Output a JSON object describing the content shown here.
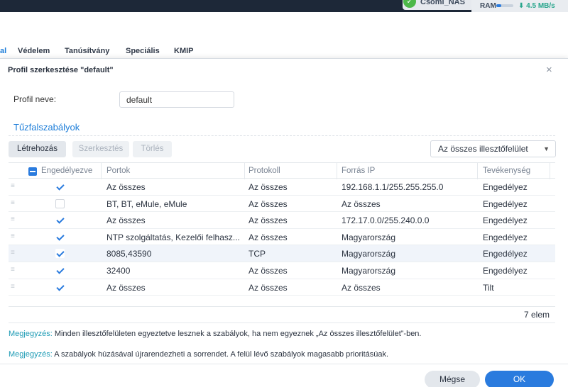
{
  "system": {
    "nas_name": "Csomi_NAS",
    "ram_label": "RAM",
    "ram_fraction": 0.3,
    "speed": "⬇ 4.5 MB/s"
  },
  "bg_tabs": [
    "al",
    "Védelem",
    "Tanúsítvány",
    "Speciális",
    "KMIP"
  ],
  "dialog": {
    "title": "Profil szerkesztése \"default\"",
    "close": "×",
    "profile_label": "Profil neve:",
    "profile_value": "default",
    "section_title": "Tűzfalszabályok",
    "toolbar": {
      "create": "Létrehozás",
      "edit": "Szerkesztés",
      "delete": "Törlés",
      "interface_select": "Az összes illesztőfelület"
    },
    "columns": {
      "enabled": "Engedélyezve",
      "ports": "Portok",
      "protocol": "Protokoll",
      "source": "Forrás IP",
      "action": "Tevékenység"
    },
    "rows": [
      {
        "enabled": true,
        "ports": "Az összes",
        "protocol": "Az összes",
        "source": "192.168.1.1/255.255.255.0",
        "action": "Engedélyez"
      },
      {
        "enabled": false,
        "ports": "BT, BT, eMule, eMule",
        "protocol": "Az összes",
        "source": "Az összes",
        "action": "Engedélyez"
      },
      {
        "enabled": true,
        "ports": "Az összes",
        "protocol": "Az összes",
        "source": "172.17.0.0/255.240.0.0",
        "action": "Engedélyez"
      },
      {
        "enabled": true,
        "ports": "NTP szolgáltatás, Kezelői felhasz...",
        "protocol": "Az összes",
        "source": "Magyarország",
        "action": "Engedélyez"
      },
      {
        "enabled": true,
        "ports": "8085,43590",
        "protocol": "TCP",
        "source": "Magyarország",
        "action": "Engedélyez"
      },
      {
        "enabled": true,
        "ports": "32400",
        "protocol": "Az összes",
        "source": "Magyarország",
        "action": "Engedélyez"
      },
      {
        "enabled": true,
        "ports": "Az összes",
        "protocol": "Az összes",
        "source": "Az összes",
        "action": "Tilt"
      }
    ],
    "count": "7 elem",
    "notes": [
      {
        "key": "Megjegyzés:",
        "text": " Minden illesztőfelületen egyeztetve lesznek a szabályok, ha nem egyeznek „Az összes illesztőfelület”-ben."
      },
      {
        "key": "Megjegyzés:",
        "text": " A szabályok húzásával újrarendezheti a sorrendet. A felül lévő szabályok magasabb prioritásúak."
      }
    ],
    "cancel": "Mégse",
    "ok": "OK"
  }
}
